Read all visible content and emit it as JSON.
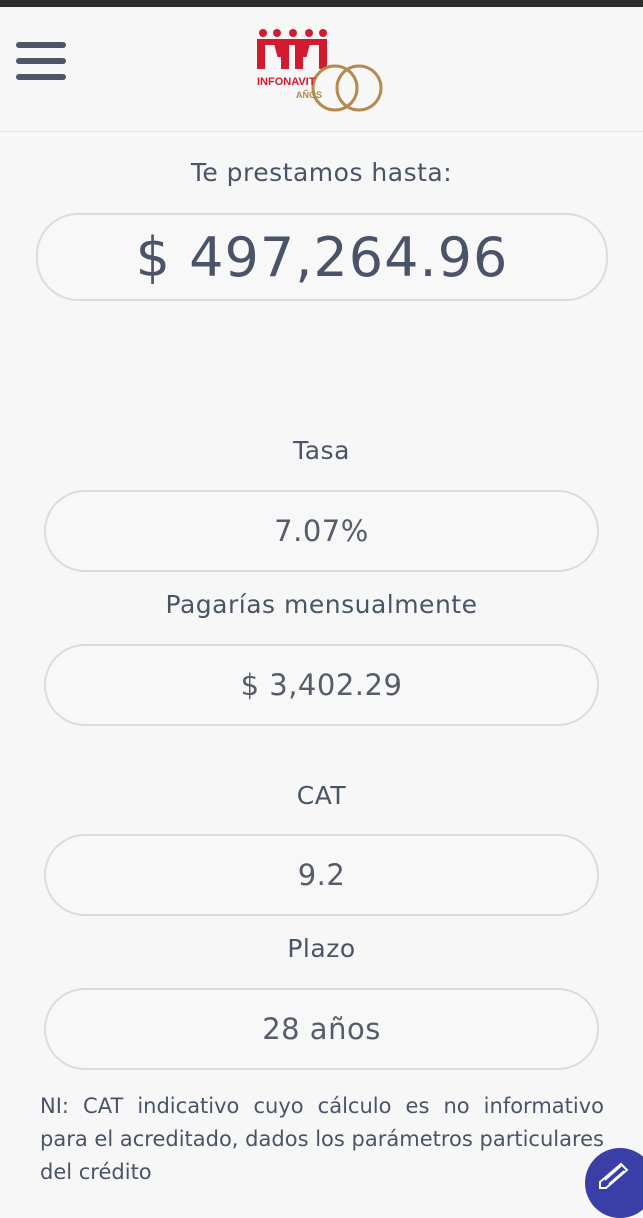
{
  "header": {
    "logo_text": "INFONAVIT",
    "logo_subtext": "AÑOS",
    "logo_colors": {
      "red": "#d21b2e",
      "gold": "#b48a4d"
    },
    "menu_icon": "hamburger-menu-icon"
  },
  "loan": {
    "label": "Te prestamos hasta:",
    "amount": "$ 497,264.96"
  },
  "details": {
    "rate_label": "Tasa",
    "rate_value": "7.07%",
    "monthly_label": "Pagarías mensualmente",
    "monthly_value": "$ 3,402.29",
    "cat_label": "CAT",
    "cat_value": "9.2",
    "term_label": "Plazo",
    "term_value": "28 años"
  },
  "note": "NI: CAT indicativo cuyo cálculo es no informativo para el acreditado, dados los parámetros particulares del crédito",
  "fab": {
    "icon": "chat-icon",
    "color": "#3a3fa8"
  }
}
